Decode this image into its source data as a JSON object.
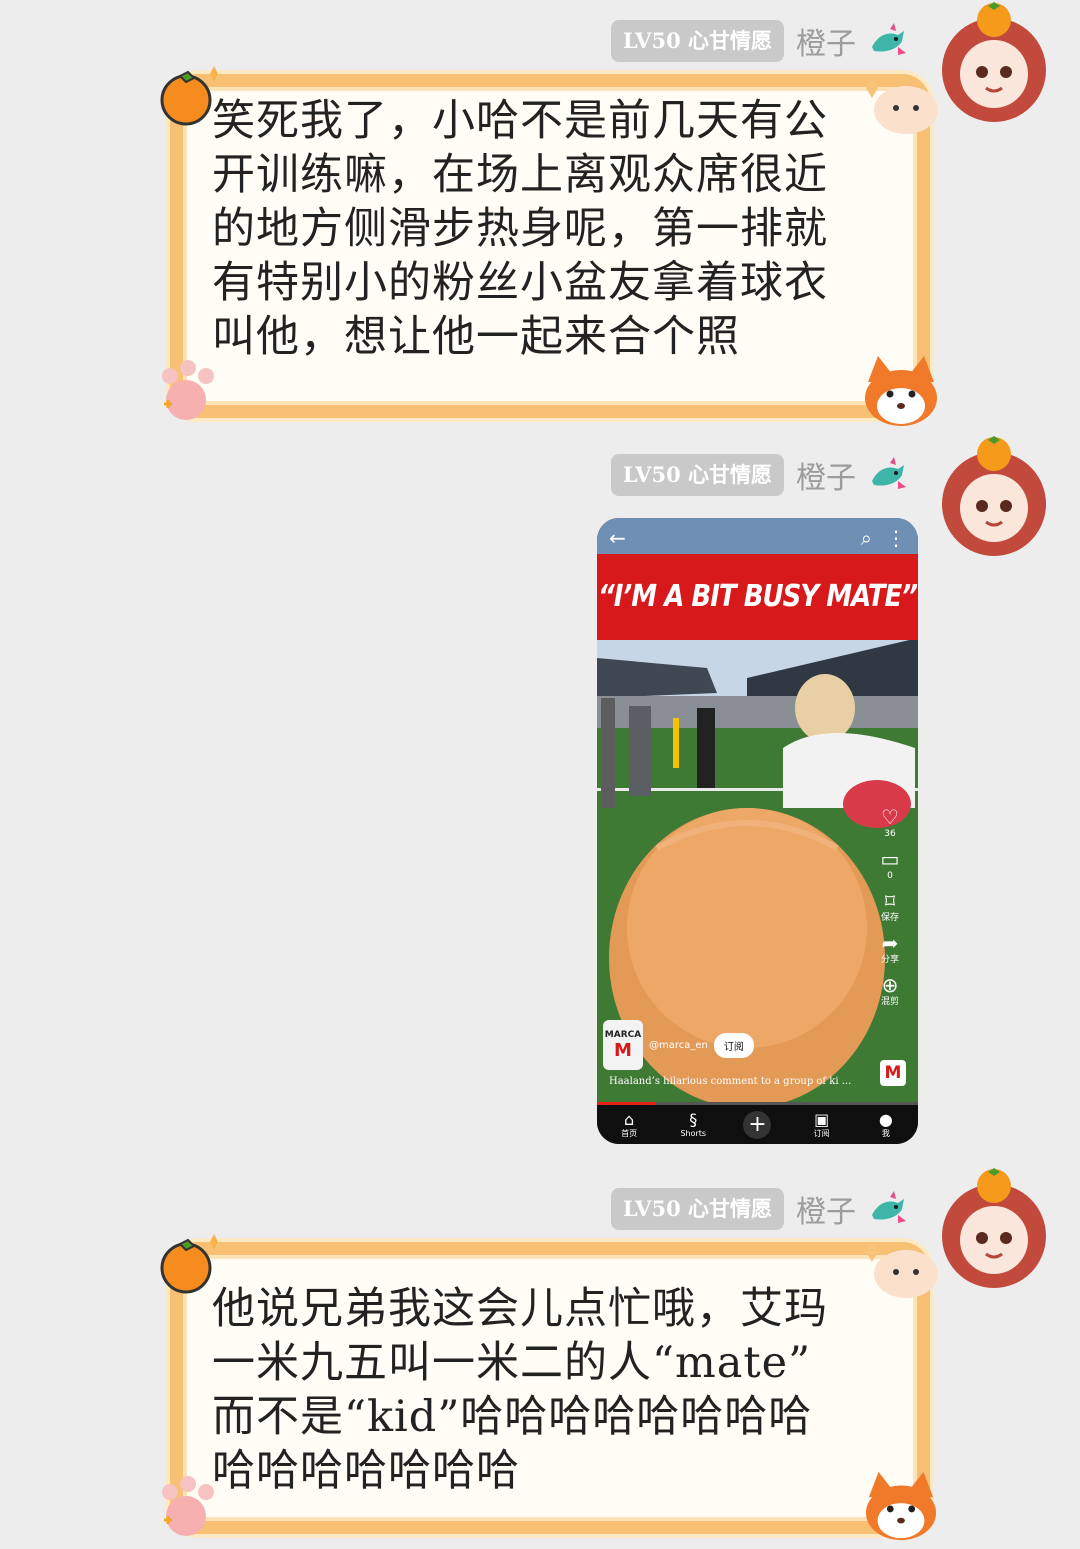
{
  "messages": [
    {
      "sender": {
        "level_badge": "LV50 心甘情愿",
        "nickname": "橙子",
        "emoji": "dragon-emoji"
      },
      "text": "笑死我了，小哈不是前几天有公\n开训练嘛，在场上离观众席很近\n的地方侧滑步热身呢，第一排就\n有特别小的粉丝小盆友拿着球衣\n叫他，想让他一起来合个照"
    },
    {
      "sender": {
        "level_badge": "LV50 心甘情愿",
        "nickname": "橙子",
        "emoji": "dragon-emoji"
      },
      "image": {
        "headline": "“I’M A BIT BUSY MATE”",
        "side_actions": [
          {
            "icon": "heart-icon",
            "label": "36"
          },
          {
            "icon": "comment-icon",
            "label": "0"
          },
          {
            "icon": "bookmark-icon",
            "label": "保存"
          },
          {
            "icon": "share-icon",
            "label": "分享"
          },
          {
            "icon": "remix-icon",
            "label": "混剪"
          }
        ],
        "channel": {
          "logo_brand": "MARCA",
          "logo_letter": "M",
          "handle": "@marca_en",
          "subscribe_label": "订阅"
        },
        "caption": "Haaland’s hilarious comment to a group of ki ...",
        "progress": 0.18,
        "bottom_nav": [
          {
            "icon": "home-icon",
            "label": "首页"
          },
          {
            "icon": "shorts-icon",
            "label": "Shorts"
          },
          {
            "icon": "plus-icon",
            "label": ""
          },
          {
            "icon": "subscriptions-icon",
            "label": "订阅"
          },
          {
            "icon": "profile-icon",
            "label": "我"
          }
        ]
      }
    },
    {
      "sender": {
        "level_badge": "LV50 心甘情愿",
        "nickname": "橙子",
        "emoji": "dragon-emoji"
      },
      "text": "他说兄弟我这会儿点忙哦，艾玛\n一米九五叫一米二的人“mate”\n而不是“kid”哈哈哈哈哈哈哈哈\n哈哈哈哈哈哈哈"
    }
  ],
  "colors": {
    "background": "#ededed",
    "frame_orange": "#f7c072",
    "badge_gray": "#c9c9c9",
    "marca_red": "#d7191c"
  }
}
